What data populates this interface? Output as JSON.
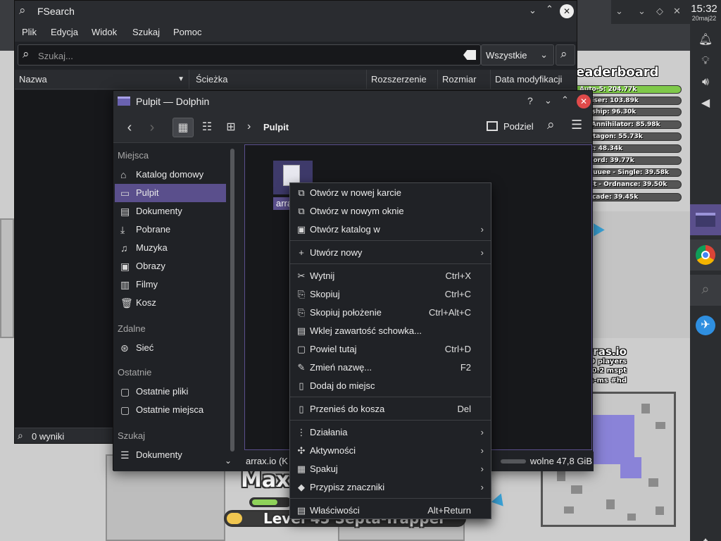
{
  "fsearch": {
    "title": "FSearch",
    "menus": [
      "Plik",
      "Edycja",
      "Widok",
      "Szukaj",
      "Pomoc"
    ],
    "search_placeholder": "Szukaj...",
    "filter": "Wszystkie",
    "columns": [
      "Nazwa",
      "Ścieżka",
      "Rozszerzenie",
      "Rozmiar",
      "Data modyfikacji"
    ],
    "status": "0 wyniki"
  },
  "dolphin": {
    "title": "Pulpit — Dolphin",
    "breadcrumb": "Pulpit",
    "split_label": "Podziel",
    "sections": {
      "places": "Miejsca",
      "remote": "Zdalne",
      "recent": "Ostatnie",
      "search": "Szukaj"
    },
    "places": [
      "Katalog domowy",
      "Pulpit",
      "Dokumenty",
      "Pobrane",
      "Muzyka",
      "Obrazy",
      "Filmy",
      "Kosz"
    ],
    "remote": [
      "Sieć"
    ],
    "recent": [
      "Ostatnie pliki",
      "Ostatnie miejsca"
    ],
    "search": [
      "Dokumenty"
    ],
    "file_label": "arra",
    "status_text": "arrax.io (K",
    "free_space": "wolne 47,8 GiB"
  },
  "context_menu": {
    "items": [
      {
        "label": "Otwórz w nowej karcie",
        "shortcut": "",
        "icon": "new-tab-icon",
        "submenu": false
      },
      {
        "label": "Otwórz w nowym oknie",
        "shortcut": "",
        "icon": "new-window-icon",
        "submenu": false
      },
      {
        "label": "Otwórz katalog w",
        "shortcut": "",
        "icon": "open-folder-icon",
        "submenu": true
      },
      {
        "label": "Utwórz nowy",
        "shortcut": "",
        "icon": "plus-icon",
        "submenu": true
      },
      {
        "label": "Wytnij",
        "shortcut": "Ctrl+X",
        "icon": "scissors-icon",
        "submenu": false
      },
      {
        "label": "Skopiuj",
        "shortcut": "Ctrl+C",
        "icon": "copy-icon",
        "submenu": false
      },
      {
        "label": "Skopiuj położenie",
        "shortcut": "Ctrl+Alt+C",
        "icon": "copy-location-icon",
        "submenu": false
      },
      {
        "label": "Wklej zawartość schowka...",
        "shortcut": "",
        "icon": "paste-icon",
        "submenu": false
      },
      {
        "label": "Powiel tutaj",
        "shortcut": "Ctrl+D",
        "icon": "duplicate-icon",
        "submenu": false
      },
      {
        "label": "Zmień nazwę...",
        "shortcut": "F2",
        "icon": "rename-icon",
        "submenu": false
      },
      {
        "label": "Dodaj do miejsc",
        "shortcut": "",
        "icon": "bookmark-icon",
        "submenu": false
      },
      {
        "label": "Przenieś do kosza",
        "shortcut": "Del",
        "icon": "trash-icon",
        "submenu": false
      },
      {
        "label": "Działania",
        "shortcut": "",
        "icon": "actions-icon",
        "submenu": true
      },
      {
        "label": "Aktywności",
        "shortcut": "",
        "icon": "activities-icon",
        "submenu": true
      },
      {
        "label": "Spakuj",
        "shortcut": "",
        "icon": "archive-icon",
        "submenu": true
      },
      {
        "label": "Przypisz znaczniki",
        "shortcut": "",
        "icon": "tag-icon",
        "submenu": true
      },
      {
        "label": "Właściwości",
        "shortcut": "Alt+Return",
        "icon": "properties-icon",
        "submenu": false
      }
    ]
  },
  "tray": {
    "time": "15:32",
    "date": "20maj22"
  },
  "game": {
    "leaderboard_title": "eaderboard",
    "leaderboard": [
      "Auto-5: 204.77k",
      "Cruiser: 103.89k",
      "ttleship: 96.30k",
      "R - Annihilator: 85.98k",
      "Pentagon: 55.73k",
      "plet: 48.34k",
      "verlord: 39.77k",
      "uuuuuee - Single: 39.58k",
      "acist - Ordnance: 39.50k",
      "arricade: 39.45k"
    ],
    "site": "arras.io",
    "players": "399 players",
    "fps": "59 FPS / 0.2 mspt",
    "server": "ms  hetzner-fsn-ms #hd",
    "player_name": "Max",
    "level_text": "Level 45 Septa-Trapper"
  },
  "colors": {
    "accent": "#5a4f8c",
    "panel": "#202226",
    "header": "#2a2c30"
  }
}
